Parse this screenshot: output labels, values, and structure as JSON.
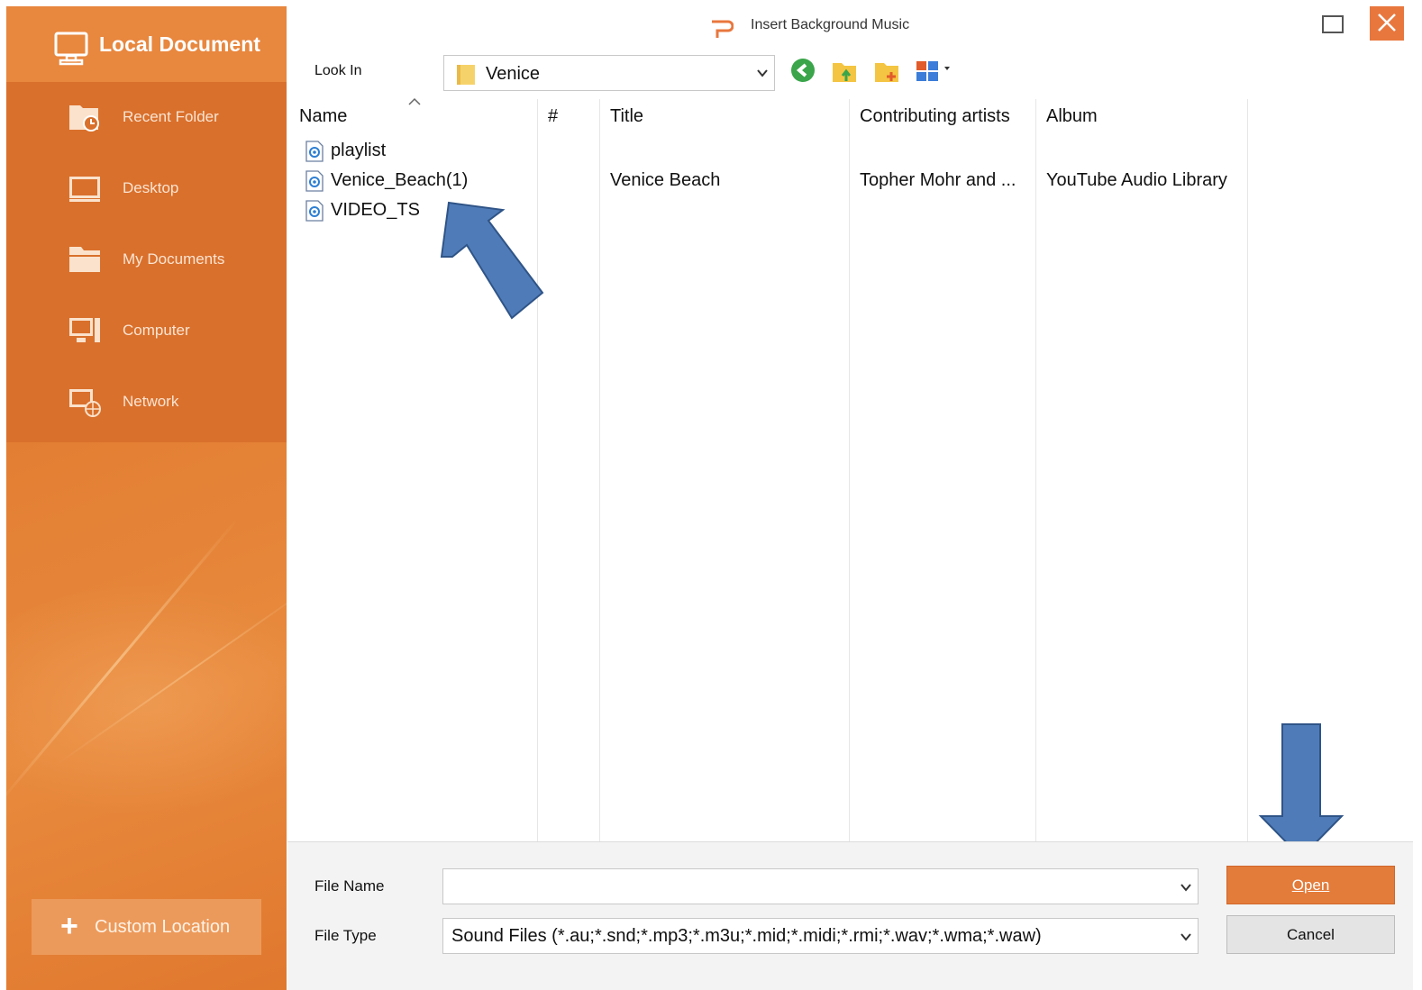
{
  "window": {
    "title": "Insert Background Music"
  },
  "sidebar": {
    "header_title": "Local Document",
    "items": [
      {
        "label": "Recent Folder",
        "icon": "recent-folder-icon"
      },
      {
        "label": "Desktop",
        "icon": "desktop-icon"
      },
      {
        "label": "My Documents",
        "icon": "my-documents-icon"
      },
      {
        "label": "Computer",
        "icon": "computer-icon"
      },
      {
        "label": "Network",
        "icon": "network-icon"
      }
    ],
    "custom_location_label": "Custom Location"
  },
  "toolbar": {
    "look_in_label": "Look In",
    "look_in_value": "Venice"
  },
  "file_list": {
    "columns": [
      "Name",
      "#",
      "Title",
      "Contributing artists",
      "Album"
    ],
    "rows": [
      {
        "name": "playlist",
        "number": "",
        "title": "",
        "artists": "",
        "album": ""
      },
      {
        "name": "Venice_Beach(1)",
        "number": "",
        "title": "Venice Beach",
        "artists": "Topher Mohr and ...",
        "album": "YouTube Audio Library"
      },
      {
        "name": "VIDEO_TS",
        "number": "",
        "title": "",
        "artists": "",
        "album": ""
      }
    ]
  },
  "footer": {
    "file_name_label": "File Name",
    "file_name_value": "",
    "file_type_label": "File Type",
    "file_type_value": "Sound Files (*.au;*.snd;*.mp3;*.m3u;*.mid;*.midi;*.rmi;*.wav;*.wma;*.waw)",
    "open_label": "Open",
    "cancel_label": "Cancel"
  },
  "colors": {
    "sidebar_orange": "#e27e33",
    "sidebar_nav": "#d9702c",
    "primary_button": "#e37b3b",
    "annotation_arrow": "#4f7cb8"
  }
}
